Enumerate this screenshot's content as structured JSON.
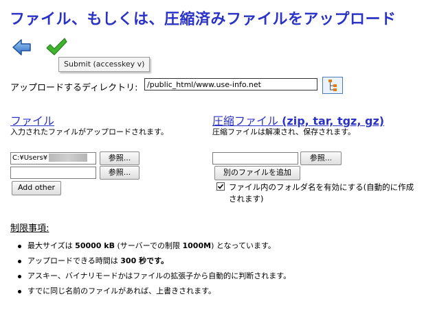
{
  "page_title": "ファイル、もしくは、圧縮済みファイルをアップロード",
  "toolbar": {
    "back_icon": "back-arrow-icon",
    "submit_icon": "checkmark-icon",
    "tooltip": "Submit (accesskey v)"
  },
  "directory": {
    "label": "アップロードするディレクトリ:",
    "value": "/public_html/www.use-info.net",
    "tree_icon": "folder-tree-icon"
  },
  "files": {
    "heading": "ファイル",
    "description": "入力されたファイルがアップロードされます。",
    "input1_value": "C:¥Users¥",
    "browse_label": "参照...",
    "add_other_label": "Add other"
  },
  "archives": {
    "heading_prefix": "圧縮ファイル",
    "heading_formats": "(zip, tar, tgz, gz)",
    "description": "圧縮ファイルは解凍され、保存されます。",
    "browse_label": "参照...",
    "add_file_label": "別のファイルを追加",
    "checkbox_checked": true,
    "checkbox_label": "ファイル内のフォルダ名を有効にする(自動的に作成されます)"
  },
  "restrictions": {
    "title": "制限事項:",
    "items": [
      {
        "pre": "最大サイズは ",
        "bold": "50000 kB",
        "mid": " (サーバーでの制限 ",
        "bold2": "1000M",
        "post": ") となっています。"
      },
      {
        "pre": "アップロードできる時間は ",
        "bold": "300 秒です。",
        "mid": "",
        "bold2": "",
        "post": ""
      },
      {
        "pre": "アスキー、バイナリモードかはファイルの拡張子から自動的に判断されます。",
        "bold": "",
        "mid": "",
        "bold2": "",
        "post": ""
      },
      {
        "pre": "すでに同じ名前のファイルがあれば、上書きされます。",
        "bold": "",
        "mid": "",
        "bold2": "",
        "post": ""
      }
    ]
  }
}
